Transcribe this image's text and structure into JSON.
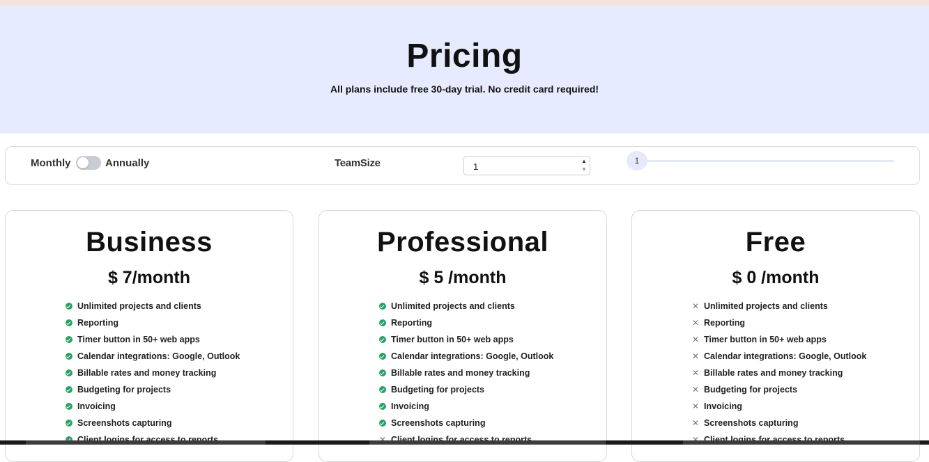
{
  "header": {
    "title": "Pricing",
    "subtitle": "All plans include free 30-day trial. No credit card required!"
  },
  "controls": {
    "monthly_label": "Monthly",
    "annually_label": "Annually",
    "billing_annual": false,
    "team_size_label": "TeamSize",
    "team_size_value": "1",
    "slider_value": "1"
  },
  "plans": [
    {
      "name": "Business",
      "price": "$ 7/month",
      "features": [
        {
          "text": "Unlimited projects and clients",
          "included": true,
          "icon": "check-circle-icon"
        },
        {
          "text": "Reporting",
          "included": true,
          "icon": "check-circle-icon"
        },
        {
          "text": "Timer button in 50+ web apps",
          "included": true,
          "icon": "check-circle-icon"
        },
        {
          "text": "Calendar integrations: Google, Outlook",
          "included": true,
          "icon": "check-circle-icon"
        },
        {
          "text": "Billable rates and money tracking",
          "included": true,
          "icon": "check-circle-icon"
        },
        {
          "text": "Budgeting for projects",
          "included": true,
          "icon": "check-circle-icon"
        },
        {
          "text": "Invoicing",
          "included": true,
          "icon": "check-circle-icon"
        },
        {
          "text": "Screenshots capturing",
          "included": true,
          "icon": "check-circle-icon"
        },
        {
          "text": "Client logins for access to reports",
          "included": true,
          "icon": "check-circle-icon"
        }
      ]
    },
    {
      "name": "Professional",
      "price": "$ 5 /month",
      "features": [
        {
          "text": "Unlimited projects and clients",
          "included": true,
          "icon": "check-circle-icon"
        },
        {
          "text": "Reporting",
          "included": true,
          "icon": "check-circle-icon"
        },
        {
          "text": "Timer button in 50+ web apps",
          "included": true,
          "icon": "check-circle-icon"
        },
        {
          "text": "Calendar integrations: Google, Outlook",
          "included": true,
          "icon": "check-circle-icon"
        },
        {
          "text": "Billable rates and money tracking",
          "included": true,
          "icon": "check-circle-icon"
        },
        {
          "text": "Budgeting for projects",
          "included": true,
          "icon": "check-circle-icon"
        },
        {
          "text": "Invoicing",
          "included": true,
          "icon": "check-circle-icon"
        },
        {
          "text": "Screenshots capturing",
          "included": true,
          "icon": "check-circle-icon"
        },
        {
          "text": "Client logins for access to reports",
          "included": false,
          "icon": "x-icon"
        }
      ]
    },
    {
      "name": "Free",
      "price": "$ 0 /month",
      "features": [
        {
          "text": "Unlimited projects and clients",
          "included": false,
          "icon": "x-icon"
        },
        {
          "text": "Reporting",
          "included": false,
          "icon": "x-icon"
        },
        {
          "text": "Timer button in 50+ web apps",
          "included": false,
          "icon": "x-icon"
        },
        {
          "text": "Calendar integrations: Google, Outlook",
          "included": false,
          "icon": "x-icon"
        },
        {
          "text": "Billable rates and money tracking",
          "included": false,
          "icon": "x-icon"
        },
        {
          "text": "Budgeting for projects",
          "included": false,
          "icon": "x-icon"
        },
        {
          "text": "Invoicing",
          "included": false,
          "icon": "x-icon"
        },
        {
          "text": "Screenshots capturing",
          "included": false,
          "icon": "x-icon"
        },
        {
          "text": "Client logins for access to reports",
          "included": false,
          "icon": "x-icon"
        }
      ]
    }
  ],
  "colors": {
    "hero_bg": "#e7ebff",
    "check": "#27a162",
    "cross": "#777777"
  }
}
